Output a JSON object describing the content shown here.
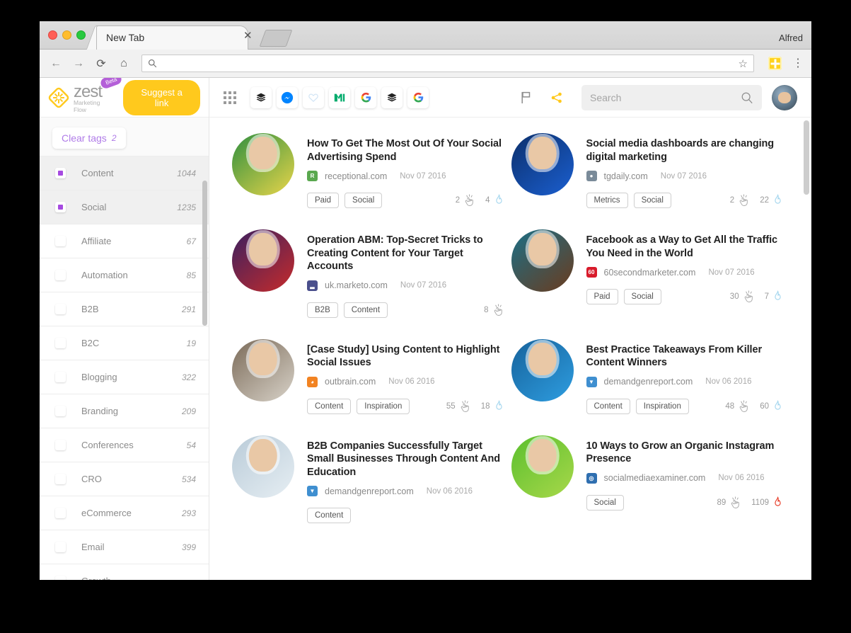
{
  "browser": {
    "tab_title": "New Tab",
    "close_label": "✕",
    "profile_name": "Alfred",
    "address_value": "",
    "address_placeholder": "",
    "back_glyph": "←",
    "forward_glyph": "→",
    "reload_glyph": "⟳",
    "home_glyph": "⌂",
    "star_glyph": "☆",
    "menu_glyph": "⋮"
  },
  "brand": {
    "name": "zest",
    "badge": "Beta",
    "tagline": "Marketing Flow",
    "suggest_label": "Suggest a link",
    "accent_yellow": "#ffc91d",
    "accent_purple": "#a64ae0"
  },
  "appbar": {
    "icons": [
      {
        "name": "apps-grid-icon",
        "label": "Apps"
      },
      {
        "name": "buffer-icon",
        "label": "Buffer"
      },
      {
        "name": "messenger-icon",
        "label": "Messenger"
      },
      {
        "name": "heart-icon",
        "label": "Pocket"
      },
      {
        "name": "medium-icon",
        "label": "Medium"
      },
      {
        "name": "google-icon",
        "label": "Google"
      },
      {
        "name": "buffer-icon-2",
        "label": "Buffer"
      },
      {
        "name": "google-icon-2",
        "label": "Google"
      }
    ],
    "flag_label": "Flag",
    "share_label": "Share",
    "search_placeholder": "Search",
    "search_value": ""
  },
  "sidebar": {
    "clear_tags_label": "Clear tags",
    "clear_tags_count": "2",
    "tags": [
      {
        "label": "Content",
        "count": "1044",
        "checked": true
      },
      {
        "label": "Social",
        "count": "1235",
        "checked": true
      },
      {
        "label": "Affiliate",
        "count": "67",
        "checked": false
      },
      {
        "label": "Automation",
        "count": "85",
        "checked": false
      },
      {
        "label": "B2B",
        "count": "291",
        "checked": false
      },
      {
        "label": "B2C",
        "count": "19",
        "checked": false
      },
      {
        "label": "Blogging",
        "count": "322",
        "checked": false
      },
      {
        "label": "Branding",
        "count": "209",
        "checked": false
      },
      {
        "label": "Conferences",
        "count": "54",
        "checked": false
      },
      {
        "label": "CRO",
        "count": "534",
        "checked": false
      },
      {
        "label": "eCommerce",
        "count": "293",
        "checked": false
      },
      {
        "label": "Email",
        "count": "399",
        "checked": false
      },
      {
        "label": "Growth",
        "count": "",
        "checked": false
      }
    ]
  },
  "feed": {
    "cards": [
      {
        "title": "How To Get The Most Out Of Your Social Advertising Spend",
        "domain": "receptional.com",
        "date": "Nov 07 2016",
        "tags": [
          "Paid",
          "Social"
        ],
        "clicks": "2",
        "flames": "4",
        "flame_hot": false,
        "favicon_letter": "R",
        "favicon_color": "#5aa84f",
        "thumb_a": "#2f8f3f",
        "thumb_b": "#e8d54a"
      },
      {
        "title": "Social media dashboards are changing digital marketing",
        "domain": "tgdaily.com",
        "date": "Nov 07 2016",
        "tags": [
          "Metrics",
          "Social"
        ],
        "clicks": "2",
        "flames": "22",
        "flame_hot": false,
        "favicon_letter": "●",
        "favicon_color": "#7a8b99",
        "thumb_a": "#0b2f6b",
        "thumb_b": "#1b5fd0"
      },
      {
        "title": "Operation ABM: Top-Secret Tricks to Creating Content for Your Target Accounts",
        "domain": "uk.marketo.com",
        "date": "Nov 07 2016",
        "tags": [
          "B2B",
          "Content"
        ],
        "clicks": "8",
        "flames": "",
        "flame_hot": false,
        "favicon_letter": "▂",
        "favicon_color": "#4a4f8c",
        "thumb_a": "#3a2060",
        "thumb_b": "#c62b2b"
      },
      {
        "title": "Facebook as a Way to Get All the Traffic You Need in the World",
        "domain": "60secondmarketer.com",
        "date": "Nov 07 2016",
        "tags": [
          "Paid",
          "Social"
        ],
        "clicks": "30",
        "flames": "7",
        "flame_hot": false,
        "favicon_letter": "60",
        "favicon_color": "#d81b2b",
        "thumb_a": "#1b6f86",
        "thumb_b": "#6b3b1e"
      },
      {
        "title": "[Case Study] Using Content to Highlight Social Issues",
        "domain": "outbrain.com",
        "date": "Nov 06 2016",
        "tags": [
          "Content",
          "Inspiration"
        ],
        "clicks": "55",
        "flames": "18",
        "flame_hot": false,
        "favicon_letter": "◕",
        "favicon_color": "#f28322",
        "thumb_a": "#7a6a58",
        "thumb_b": "#d8d2c8"
      },
      {
        "title": "Best Practice Takeaways From Killer Content Winners",
        "domain": "demandgenreport.com",
        "date": "Nov 06 2016",
        "tags": [
          "Content",
          "Inspiration"
        ],
        "clicks": "48",
        "flames": "60",
        "flame_hot": false,
        "favicon_letter": "▼",
        "favicon_color": "#3f8fd0",
        "thumb_a": "#16629b",
        "thumb_b": "#2e9de0"
      },
      {
        "title": "B2B Companies Successfully Target Small Businesses Through Content And Education",
        "domain": "demandgenreport.com",
        "date": "Nov 06 2016",
        "tags": [
          "Content"
        ],
        "clicks": "",
        "flames": "",
        "flame_hot": false,
        "favicon_letter": "▼",
        "favicon_color": "#3f8fd0",
        "thumb_a": "#b9cbd8",
        "thumb_b": "#e6eef3"
      },
      {
        "title": "10 Ways to Grow an Organic Instagram Presence",
        "domain": "socialmediaexaminer.com",
        "date": "Nov 06 2016",
        "tags": [
          "Social"
        ],
        "clicks": "89",
        "flames": "1109",
        "flame_hot": true,
        "favicon_letter": "◎",
        "favicon_color": "#2f6fb0",
        "thumb_a": "#5bbf2e",
        "thumb_b": "#a8d84a"
      }
    ]
  }
}
